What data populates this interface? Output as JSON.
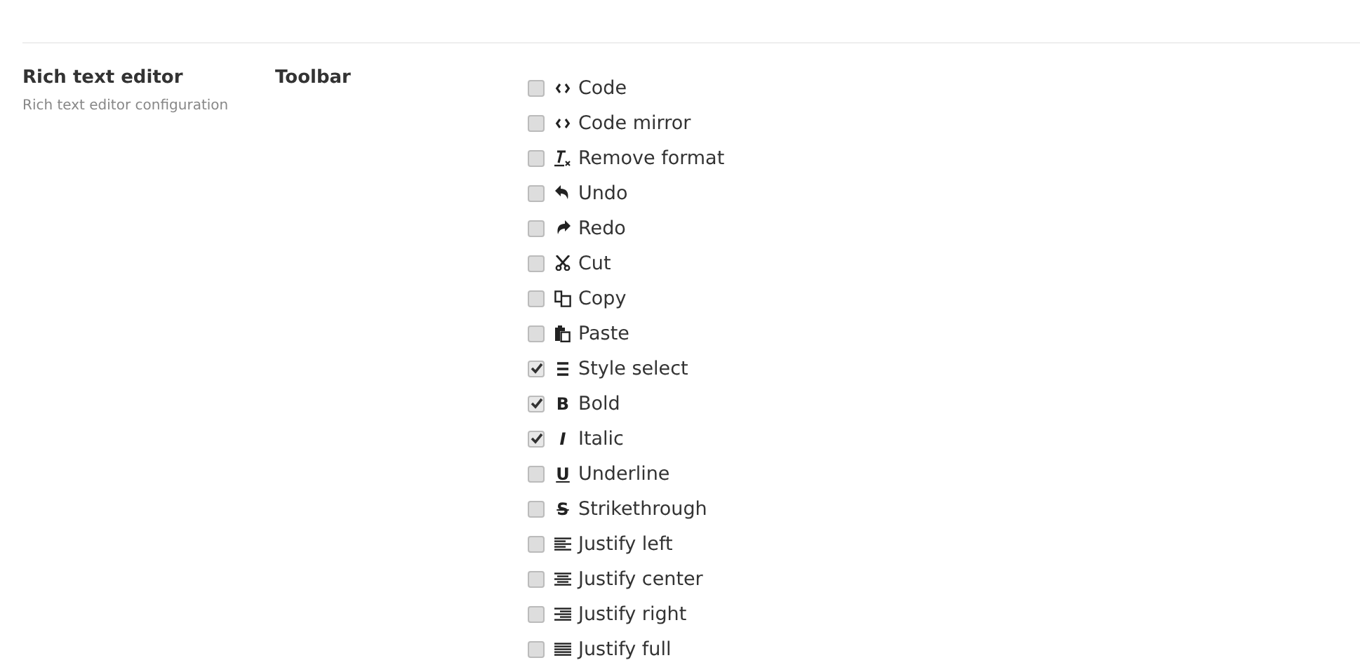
{
  "section": {
    "title": "Rich text editor",
    "description": "Rich text editor configuration"
  },
  "field": {
    "label": "Toolbar"
  },
  "options": [
    {
      "label": "Code",
      "checked": false,
      "kind": "code"
    },
    {
      "label": "Code mirror",
      "checked": false,
      "kind": "code"
    },
    {
      "label": "Remove format",
      "checked": false,
      "kind": "clear"
    },
    {
      "label": "Undo",
      "checked": false,
      "kind": "undo"
    },
    {
      "label": "Redo",
      "checked": false,
      "kind": "redo"
    },
    {
      "label": "Cut",
      "checked": false,
      "kind": "cut"
    },
    {
      "label": "Copy",
      "checked": false,
      "kind": "copy"
    },
    {
      "label": "Paste",
      "checked": false,
      "kind": "paste"
    },
    {
      "label": "Style select",
      "checked": true,
      "kind": "lines"
    },
    {
      "label": "Bold",
      "checked": true,
      "kind": "glyph",
      "glyph": "B"
    },
    {
      "label": "Italic",
      "checked": true,
      "kind": "glyph",
      "glyph": "I"
    },
    {
      "label": "Underline",
      "checked": false,
      "kind": "glyph",
      "glyph": "U"
    },
    {
      "label": "Strikethrough",
      "checked": false,
      "kind": "glyph",
      "glyph": "S"
    },
    {
      "label": "Justify left",
      "checked": false,
      "kind": "align-left"
    },
    {
      "label": "Justify center",
      "checked": false,
      "kind": "align-center"
    },
    {
      "label": "Justify right",
      "checked": false,
      "kind": "align-right"
    },
    {
      "label": "Justify full",
      "checked": false,
      "kind": "align-full"
    }
  ]
}
